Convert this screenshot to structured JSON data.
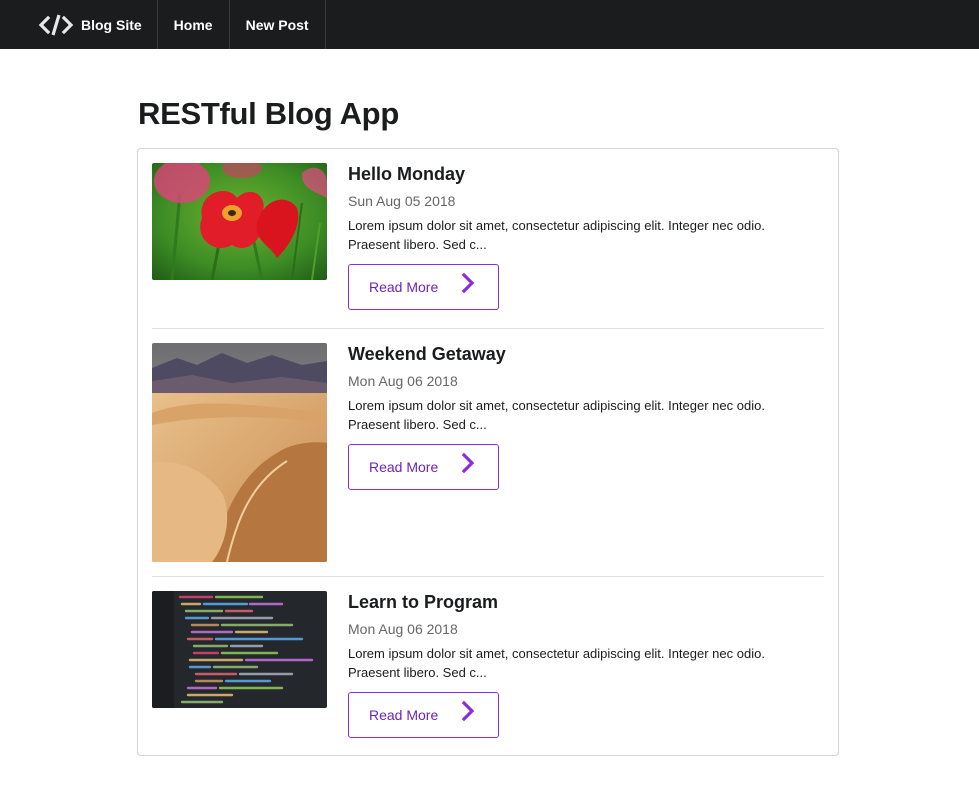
{
  "navbar": {
    "brand": "Blog Site",
    "items": [
      {
        "label": "Home"
      },
      {
        "label": "New Post"
      }
    ]
  },
  "page": {
    "title": "RESTful Blog App"
  },
  "posts": [
    {
      "title": "Hello Monday",
      "date": "Sun Aug 05 2018",
      "excerpt": "Lorem ipsum dolor sit amet, consectetur adipiscing elit. Integer nec odio. Praesent libero. Sed c...",
      "button": "Read More"
    },
    {
      "title": "Weekend Getaway",
      "date": "Mon Aug 06 2018",
      "excerpt": "Lorem ipsum dolor sit amet, consectetur adipiscing elit. Integer nec odio. Praesent libero. Sed c...",
      "button": "Read More"
    },
    {
      "title": "Learn to Program",
      "date": "Mon Aug 06 2018",
      "excerpt": "Lorem ipsum dolor sit amet, consectetur adipiscing elit. Integer nec odio. Praesent libero. Sed c...",
      "button": "Read More"
    }
  ],
  "colors": {
    "navbar_bg": "#1b1c1d",
    "accent": "#8a2be2"
  }
}
